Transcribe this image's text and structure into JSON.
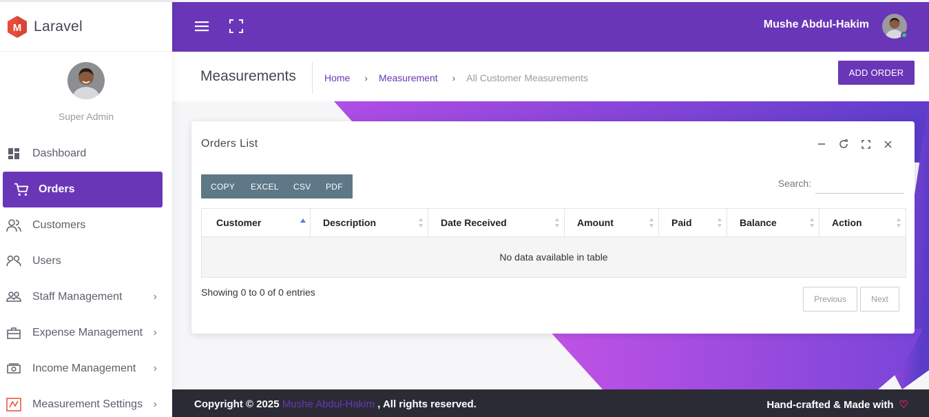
{
  "brand": {
    "name": "Laravel",
    "logo_letter": "M",
    "logo_color": "#e74c3c"
  },
  "topbar": {
    "user_name": "Mushe Abdul-Hakim",
    "bg_color": "#6a36b8",
    "menu_icon": "hamburger-icon",
    "fullscreen_icon": "fullscreen-icon"
  },
  "sidebar": {
    "role": "Super Admin",
    "items": [
      {
        "label": "Dashboard",
        "icon": "dashboard-icon",
        "active": false,
        "has_submenu": false
      },
      {
        "label": "Orders",
        "icon": "cart-icon",
        "active": true,
        "has_submenu": false
      },
      {
        "label": "Customers",
        "icon": "customers-icon",
        "active": false,
        "has_submenu": false
      },
      {
        "label": "Users",
        "icon": "users-icon",
        "active": false,
        "has_submenu": false
      },
      {
        "label": "Staff Management",
        "icon": "staff-icon",
        "active": false,
        "has_submenu": true
      },
      {
        "label": "Expense Management",
        "icon": "briefcase-icon",
        "active": false,
        "has_submenu": true
      },
      {
        "label": "Income Management",
        "icon": "money-icon",
        "active": false,
        "has_submenu": true
      },
      {
        "label": "Measurement Settings",
        "icon": "settings-icon",
        "active": false,
        "has_submenu": true
      }
    ]
  },
  "page": {
    "title": "Measurements",
    "breadcrumb": [
      "Home",
      "Measurement",
      "All Customer Measurements"
    ],
    "add_button": "ADD ORDER"
  },
  "card": {
    "title": "Orders List",
    "tools": [
      "minimize-icon",
      "refresh-icon",
      "expand-icon",
      "close-icon"
    ],
    "export_buttons": [
      "COPY",
      "EXCEL",
      "CSV",
      "PDF"
    ],
    "search_label": "Search:",
    "search_value": "",
    "table": {
      "columns": [
        "Customer",
        "Description",
        "Date Received",
        "Amount",
        "Paid",
        "Balance",
        "Action"
      ],
      "sorted_column": "Customer",
      "empty_message": "No data available in table"
    },
    "info": "Showing 0 to 0 of 0 entries",
    "pagination": {
      "previous": "Previous",
      "next": "Next"
    }
  },
  "footer": {
    "copyright_prefix": "Copyright © 2025",
    "author": "Mushe Abdul-Hakim",
    "copyright_suffix": ", All rights reserved.",
    "credit": "Hand-crafted & Made with",
    "heart": "♡"
  }
}
